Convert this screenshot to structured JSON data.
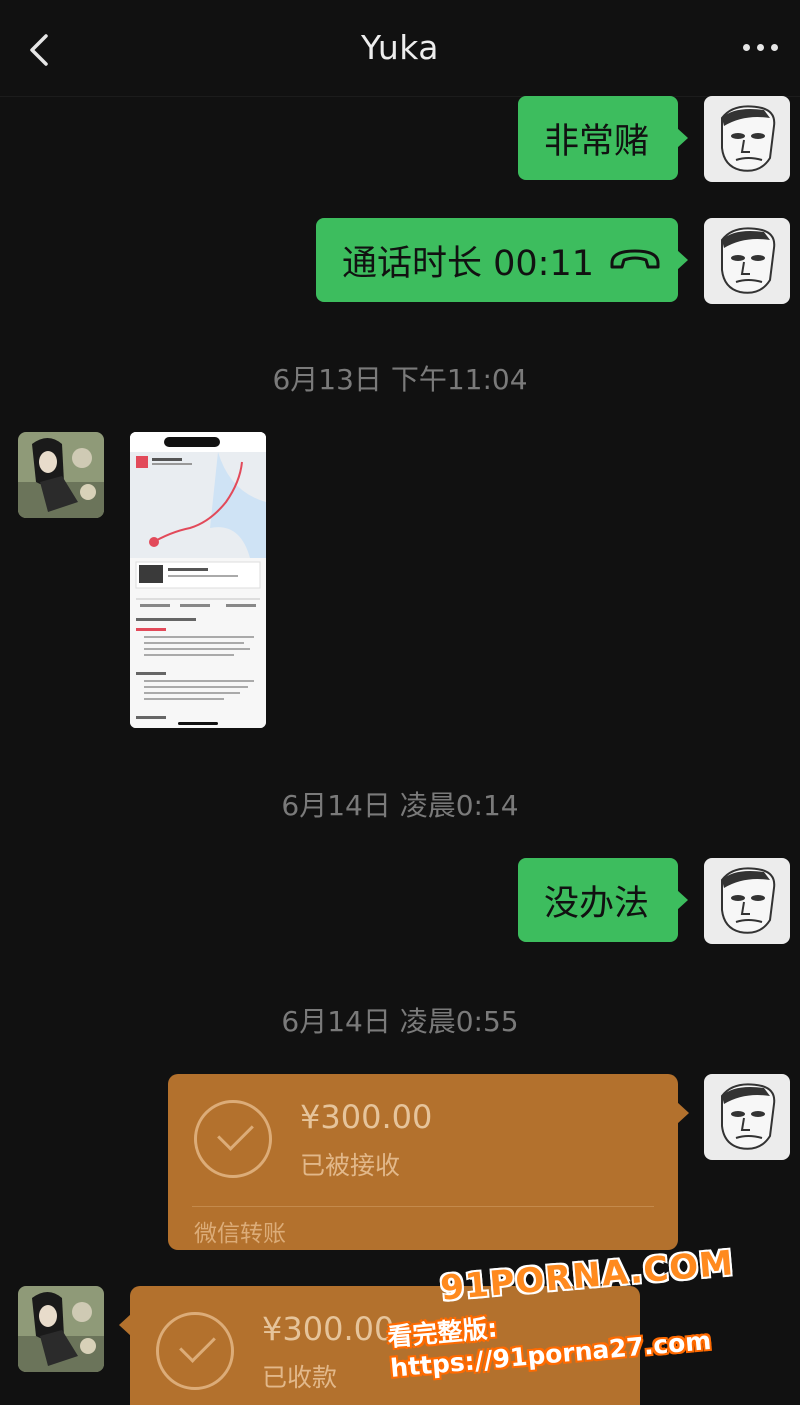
{
  "header": {
    "title": "Yuka",
    "back_icon": "chevron-left-icon",
    "more_icon": "more-dots-icon"
  },
  "messages": {
    "m1": {
      "text": "非常赌"
    },
    "m2": {
      "text": "通话时长 00:11",
      "icon": "phone-hangup-icon"
    },
    "ts1": "6月13日 下午11:04",
    "ts2": "6月14日 凌晨0:14",
    "m3": {
      "text": "没办法"
    },
    "ts3": "6月14日 凌晨0:55",
    "transfer1": {
      "amount": "¥300.00",
      "status": "已被接收",
      "label": "微信转账"
    },
    "transfer2": {
      "amount": "¥300.00",
      "status": "已收款"
    }
  },
  "watermark": {
    "line1": "91PORNA.COM",
    "line2": "看完整版: https://91porna27.com"
  },
  "colors": {
    "background": "#111111",
    "bubble_green": "#3dbd5e",
    "transfer_orange": "#b3712d",
    "timestamp": "#7a7a7a"
  }
}
